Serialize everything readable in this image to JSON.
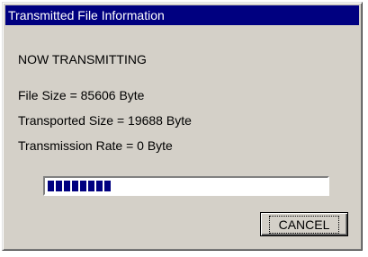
{
  "window": {
    "title": "Transmitted File Information"
  },
  "status": {
    "heading": "NOW TRANSMITTING",
    "file_size": "File Size = 85606 Byte",
    "transported_size": "Transported Size = 19688 Byte",
    "transmission_rate": "Transmission Rate = 0 Byte"
  },
  "progress": {
    "fraction": 0.23
  },
  "buttons": {
    "cancel_label": "CANCEL"
  },
  "colors": {
    "title_bar": "#000080",
    "progress_fill": "#000080",
    "dialog_face": "#d4d0c8"
  }
}
